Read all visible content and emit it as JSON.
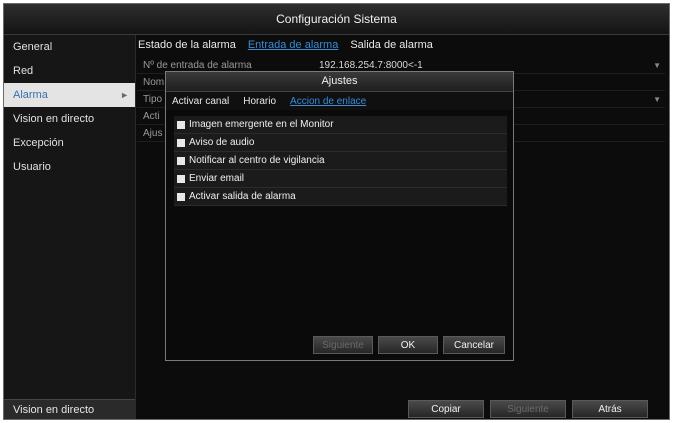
{
  "window": {
    "title": "Configuración Sistema"
  },
  "sidebar": {
    "items": [
      {
        "label": "General"
      },
      {
        "label": "Red"
      },
      {
        "label": "Alarma",
        "arrow": "►"
      },
      {
        "label": "Vision en directo"
      },
      {
        "label": "Excepción"
      },
      {
        "label": "Usuario"
      }
    ],
    "bottom_label": "Vision en directo"
  },
  "main": {
    "tabs": [
      {
        "label": "Estado de la alarma"
      },
      {
        "label": "Entrada de alarma"
      },
      {
        "label": "Salida de alarma"
      }
    ],
    "rows": [
      {
        "label": "Nº de entrada de alarma",
        "value": "192.168.254.7:8000<-1"
      },
      {
        "label": "Nom",
        "value": ""
      },
      {
        "label": "Tipo",
        "value": ""
      },
      {
        "label": "Acti",
        "value": ""
      },
      {
        "label": "Ajus",
        "value": ""
      }
    ]
  },
  "dialog": {
    "title": "Ajustes",
    "tabs": [
      {
        "label": "Activar canal"
      },
      {
        "label": "Horario"
      },
      {
        "label": "Accion de enlace"
      }
    ],
    "options": [
      {
        "label": "Imagen emergente en el Monitor",
        "checked": false
      },
      {
        "label": "Aviso de audio",
        "checked": false
      },
      {
        "label": "Notificar al centro de vigilancia",
        "checked": false
      },
      {
        "label": "Enviar email",
        "checked": false
      },
      {
        "label": "Activar salida de alarma",
        "checked": false
      }
    ],
    "buttons": {
      "next": "Siguiente",
      "ok": "OK",
      "cancel": "Cancelar"
    }
  },
  "footer": {
    "copy": "Copiar",
    "next": "Siguiente",
    "back": "Atrás"
  },
  "colors": {
    "accent": "#3a8ad6",
    "background": "#0c0c0c",
    "selected": "#e4e4e4"
  }
}
